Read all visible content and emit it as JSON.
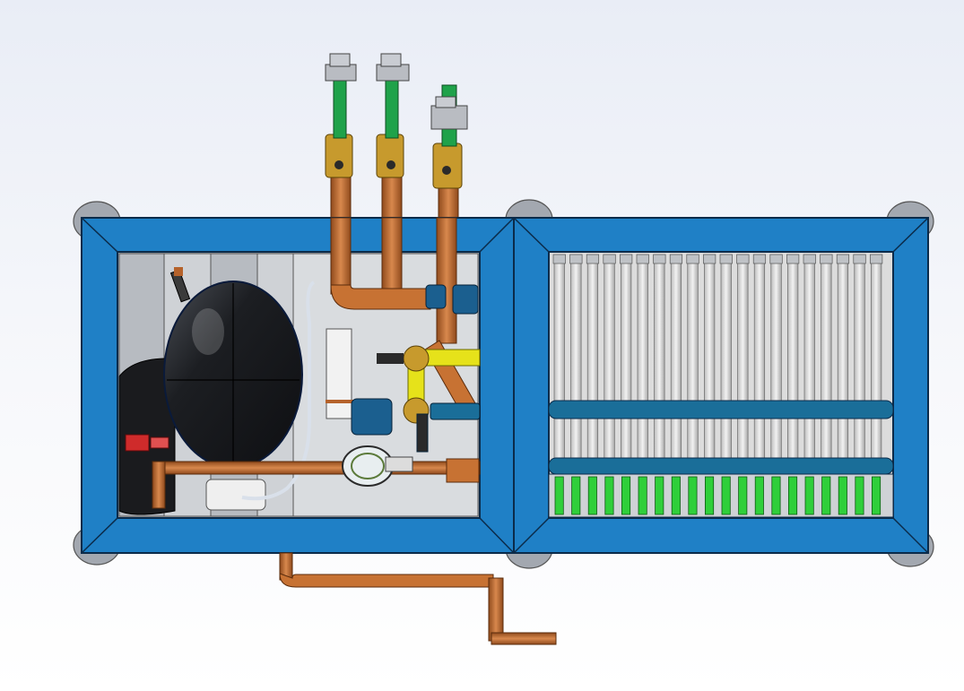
{
  "scene": {
    "description_visible_text": "",
    "colors": {
      "background_top": "#e9edf6",
      "background_bottom": "#ffffff",
      "frame_blue": "#1f80c6",
      "frame_dark": "#0b2b4a",
      "copper": "#b5622b",
      "copper_light": "#d8884d",
      "valve_green": "#1fa24a",
      "brass": "#c79a2d",
      "yellow_pipe": "#e6e21a",
      "manifold_blue": "#1a6e99",
      "tube_gray": "#d9d9d9",
      "connector_green": "#2fcf3a",
      "compressor_black": "#1c1e22",
      "foot_gray": "#9aa0a8"
    },
    "valve_count": 3,
    "heat_exchanger_tube_count": 20
  }
}
